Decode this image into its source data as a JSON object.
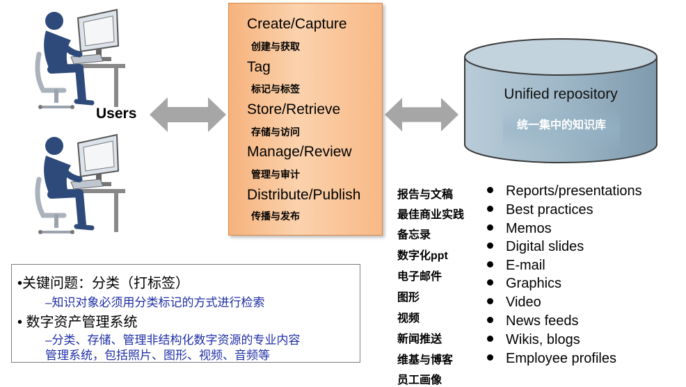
{
  "users": {
    "label": "Users"
  },
  "process": {
    "steps": [
      {
        "en": "Create/Capture",
        "zh": "创建与获取"
      },
      {
        "en": "Tag",
        "zh": "标记与标签"
      },
      {
        "en": "Store/Retrieve",
        "zh": "存储与访问"
      },
      {
        "en": "Manage/Review",
        "zh": "管理与审计"
      },
      {
        "en": "Distribute/Publish",
        "zh": "传播与发布"
      }
    ]
  },
  "repository": {
    "title": "Unified repository",
    "subtitle": "统一集中的知识库"
  },
  "content_types": {
    "zh": [
      "报告与文稿",
      "最佳商业实践",
      "备忘录",
      "数字化ppt",
      "电子邮件",
      "图形",
      "视频",
      "新闻推送",
      "维基与博客",
      "员工画像"
    ],
    "en": [
      "Reports/presentations",
      "Best practices",
      "Memos",
      "Digital slides",
      "E-mail",
      "Graphics",
      "Video",
      "News feeds",
      "Wikis, blogs",
      "Employee profiles"
    ]
  },
  "notes": {
    "issue": "•关键问题：分类（打标签）",
    "issue_detail": "–知识对象必须用分类标记的方式进行检索",
    "dam": "•  数字资产管理系统",
    "dam_detail_1": "–分类、存储、管理非结构化数字资源的专业内容",
    "dam_detail_2": "管理系统，包括照片、图形、视频、音频等"
  },
  "colors": {
    "arrow": "#a6a6a6",
    "process_fill": "#f8b986",
    "repository_fill": "#9fb8c8",
    "figure": "#2d4a7a",
    "note_blue": "#1f2fa5"
  },
  "icons": [
    "person-at-computer-icon",
    "double-arrow-icon",
    "database-cylinder-icon"
  ]
}
